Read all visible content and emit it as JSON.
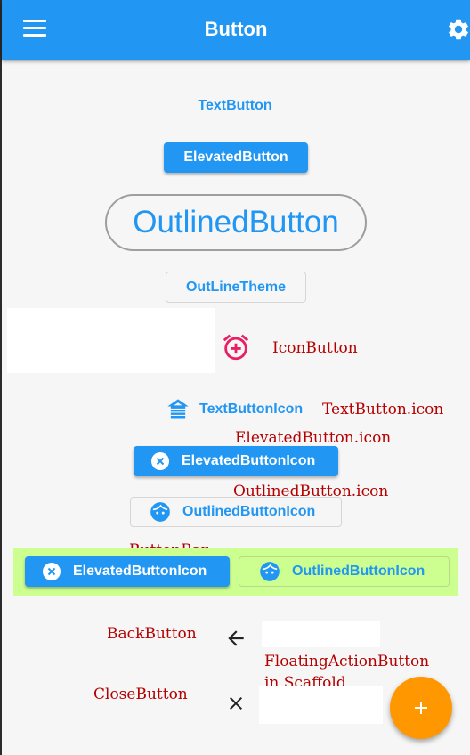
{
  "appbar": {
    "title": "Button",
    "menu_icon": "menu-icon",
    "settings_icon": "gear-icon",
    "color": "#2196f3"
  },
  "buttons": {
    "text_button": "TextButton",
    "elevated_button": "ElevatedButton",
    "outlined_button": "OutlinedButton",
    "outline_theme": "OutLineTheme",
    "text_button_icon": "TextButtonIcon",
    "elevated_button_icon": "ElevatedButtonIcon",
    "outlined_button_icon": "OutlinedButtonIcon"
  },
  "labels": {
    "icon_button": "IconButton",
    "text_button_icon": "TextButton.icon",
    "elevated_button_icon": "ElevatedButton.icon",
    "outlined_button_icon": "OutlinedButton.icon",
    "button_bar": "ButtonBar",
    "back_button": "BackButton",
    "fab_line1": "FloatingActionButton",
    "fab_line2": "in Scaffold",
    "close_button": "CloseButton"
  },
  "button_bar": {
    "elevated_label": "ElevatedButtonIcon",
    "outlined_label": "OutlinedButtonIcon",
    "background": "#ccff90"
  },
  "icons": {
    "icon_button": "alarm-add-icon",
    "text_button_icon": "house-icon",
    "elevated_button_icon": "cancel-icon",
    "outlined_button_icon": "face-icon",
    "back": "arrow-back-icon",
    "close": "close-icon",
    "fab": "add-icon"
  },
  "colors": {
    "primary": "#2196f3",
    "accent": "#ff9800",
    "icon_button": "#e91e63",
    "label_red": "#b40000"
  }
}
